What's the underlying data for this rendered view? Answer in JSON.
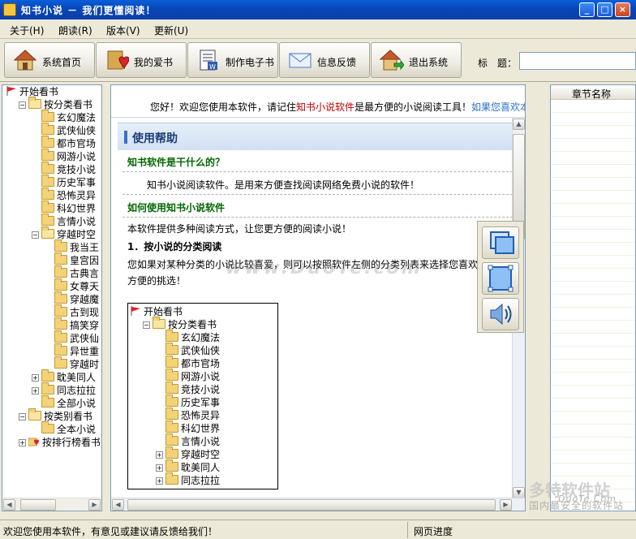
{
  "window": {
    "title": "知书小说 － 我们更懂阅读！"
  },
  "menu": [
    {
      "label": "关于(H)"
    },
    {
      "label": "朗读(R)"
    },
    {
      "label": "版本(V)"
    },
    {
      "label": "更新(U)"
    }
  ],
  "toolbar": {
    "buttons": [
      {
        "label": "系统首页",
        "icon": "house-icon"
      },
      {
        "label": "我的爱书",
        "icon": "heart-book-icon"
      },
      {
        "label": "制作电子书",
        "icon": "ebook-icon"
      },
      {
        "label": "信息反馈",
        "icon": "envelope-icon"
      },
      {
        "label": "退出系统",
        "icon": "exit-house-icon"
      }
    ],
    "title_label": "标　题：",
    "title_value": ""
  },
  "left_tree": {
    "root": "开始看书",
    "items": [
      {
        "label": "按分类看书",
        "level": 1,
        "type": "folder-open",
        "pm": "−"
      },
      {
        "label": "玄幻魔法",
        "level": 2,
        "type": "folder"
      },
      {
        "label": "武侠仙侠",
        "level": 2,
        "type": "folder"
      },
      {
        "label": "都市官场",
        "level": 2,
        "type": "folder"
      },
      {
        "label": "网游小说",
        "level": 2,
        "type": "folder"
      },
      {
        "label": "竞技小说",
        "level": 2,
        "type": "folder"
      },
      {
        "label": "历史军事",
        "level": 2,
        "type": "folder"
      },
      {
        "label": "恐怖灵异",
        "level": 2,
        "type": "folder"
      },
      {
        "label": "科幻世界",
        "level": 2,
        "type": "folder"
      },
      {
        "label": "言情小说",
        "level": 2,
        "type": "folder"
      },
      {
        "label": "穿越时空",
        "level": 2,
        "type": "folder-open",
        "pm": "−"
      },
      {
        "label": "我当王",
        "level": 3,
        "type": "folder"
      },
      {
        "label": "皇宫因",
        "level": 3,
        "type": "folder"
      },
      {
        "label": "古典言",
        "level": 3,
        "type": "folder"
      },
      {
        "label": "女尊天",
        "level": 3,
        "type": "folder"
      },
      {
        "label": "穿越魔",
        "level": 3,
        "type": "folder"
      },
      {
        "label": "古到现",
        "level": 3,
        "type": "folder"
      },
      {
        "label": "搞笑穿",
        "level": 3,
        "type": "folder"
      },
      {
        "label": "武侠仙",
        "level": 3,
        "type": "folder"
      },
      {
        "label": "异世重",
        "level": 3,
        "type": "folder"
      },
      {
        "label": "穿越时",
        "level": 3,
        "type": "folder"
      },
      {
        "label": "耽美同人",
        "level": 2,
        "type": "folder",
        "pm": "+"
      },
      {
        "label": "同志拉拉",
        "level": 2,
        "type": "folder",
        "pm": "+"
      },
      {
        "label": "全部小说",
        "level": 2,
        "type": "folder"
      },
      {
        "label": "按类别看书",
        "level": 1,
        "type": "folder-open",
        "pm": "−"
      },
      {
        "label": "全本小说",
        "level": 2,
        "type": "folder"
      },
      {
        "label": "按排行榜看书",
        "level": 1,
        "type": "heart",
        "pm": "+"
      }
    ]
  },
  "content": {
    "welcome_prefix": "您好！欢迎您使用本软件，请记住",
    "welcome_brand": "知书小说软件",
    "welcome_suffix": "是最方便的小说阅读工具！",
    "welcome_link": "如果您喜欢本",
    "help_title": "使用帮助",
    "q1": "知书软件是干什么的？",
    "a1": "知书小说阅读软件。是用来方便查找阅读网络免费小说的软件！",
    "q2": "如何使用知书小说软件",
    "p1": "本软件提供多种阅读方式，让您更方便的阅读小说！",
    "sec1": "1．按小说的分类阅读",
    "p2": "您如果对某种分类的小说比较喜爱，则可以按照软件左侧的分类列表来选择您喜欢的",
    "p3": "方便的挑选！"
  },
  "inner_tree": {
    "root": "开始看书",
    "items": [
      {
        "label": "按分类看书",
        "level": 1,
        "type": "folder-open",
        "pm": "−"
      },
      {
        "label": "玄幻魔法",
        "level": 2,
        "type": "folder"
      },
      {
        "label": "武侠仙侠",
        "level": 2,
        "type": "folder"
      },
      {
        "label": "都市官场",
        "level": 2,
        "type": "folder"
      },
      {
        "label": "网游小说",
        "level": 2,
        "type": "folder"
      },
      {
        "label": "竞技小说",
        "level": 2,
        "type": "folder"
      },
      {
        "label": "历史军事",
        "level": 2,
        "type": "folder"
      },
      {
        "label": "恐怖灵异",
        "level": 2,
        "type": "folder"
      },
      {
        "label": "科幻世界",
        "level": 2,
        "type": "folder"
      },
      {
        "label": "言情小说",
        "level": 2,
        "type": "folder"
      },
      {
        "label": "穿越时空",
        "level": 2,
        "type": "folder",
        "pm": "+"
      },
      {
        "label": "耽美同人",
        "level": 2,
        "type": "folder",
        "pm": "+"
      },
      {
        "label": "同志拉拉",
        "level": 2,
        "type": "folder",
        "pm": "+"
      }
    ]
  },
  "float_tools": [
    {
      "icon": "restore-window-icon"
    },
    {
      "icon": "fullscreen-icon"
    },
    {
      "icon": "speaker-icon"
    }
  ],
  "right_panel": {
    "header": "章节名称"
  },
  "watermarks": {
    "center": "www.DuoTe.com",
    "brand": "多特软件站",
    "brand_url": "DuoTe.Com",
    "slogan": "国内最安全的软件站"
  },
  "status": {
    "main": "欢迎您使用本软件，有意见或建议请反馈给我们！",
    "progress": "网页进度"
  },
  "colors": {
    "titlebar": "#0A5FD8",
    "brand_red": "#C00000",
    "link_blue": "#2A70C8",
    "question_green": "#006600"
  }
}
